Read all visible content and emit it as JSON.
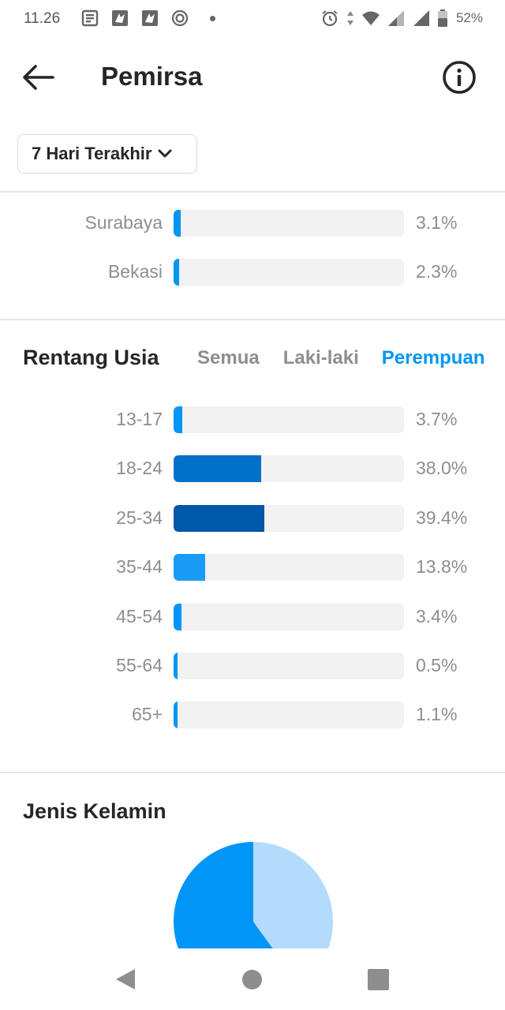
{
  "status_bar": {
    "time": "11.26",
    "battery": "52%"
  },
  "header": {
    "title": "Pemirsa"
  },
  "filter": {
    "range_label": "7 Hari Terakhir"
  },
  "locations": {
    "rows": [
      {
        "label": "Surabaya",
        "value": "3.1%",
        "fraction": 0.031,
        "color": "#0095f6"
      },
      {
        "label": "Bekasi",
        "value": "2.3%",
        "fraction": 0.023,
        "color": "#0095f6"
      }
    ]
  },
  "age": {
    "title": "Rentang Usia",
    "tabs": [
      {
        "label": "Semua",
        "active": false
      },
      {
        "label": "Laki-laki",
        "active": false
      },
      {
        "label": "Perempuan",
        "active": true
      }
    ],
    "rows": [
      {
        "label": "13-17",
        "value": "3.7%",
        "fraction": 0.037,
        "color": "#0095f6"
      },
      {
        "label": "18-24",
        "value": "38.0%",
        "fraction": 0.38,
        "color": "#0070c9"
      },
      {
        "label": "25-34",
        "value": "39.4%",
        "fraction": 0.394,
        "color": "#0058a8"
      },
      {
        "label": "35-44",
        "value": "13.8%",
        "fraction": 0.138,
        "color": "#1a9bf7"
      },
      {
        "label": "45-54",
        "value": "3.4%",
        "fraction": 0.034,
        "color": "#0095f6"
      },
      {
        "label": "55-64",
        "value": "0.5%",
        "fraction": 0.005,
        "color": "#0095f6"
      },
      {
        "label": "65+",
        "value": "1.1%",
        "fraction": 0.011,
        "color": "#0095f6"
      }
    ]
  },
  "gender": {
    "title": "Jenis Kelamin",
    "slices": [
      {
        "fraction": 0.6,
        "color": "#0095f6"
      },
      {
        "fraction": 0.4,
        "color": "#b3dbfb"
      }
    ]
  },
  "icons": {
    "status_left": [
      "news-icon",
      "app-notification-icon",
      "app-notification-icon",
      "sync-icon",
      "dot-icon"
    ],
    "status_right": [
      "alarm-icon",
      "data-arrows-icon",
      "wifi-icon",
      "signal-icon",
      "signal-icon",
      "battery-icon"
    ],
    "header": [
      "back-arrow-icon",
      "info-icon"
    ],
    "nav": [
      "nav-back-icon",
      "nav-home-icon",
      "nav-recents-icon"
    ]
  }
}
